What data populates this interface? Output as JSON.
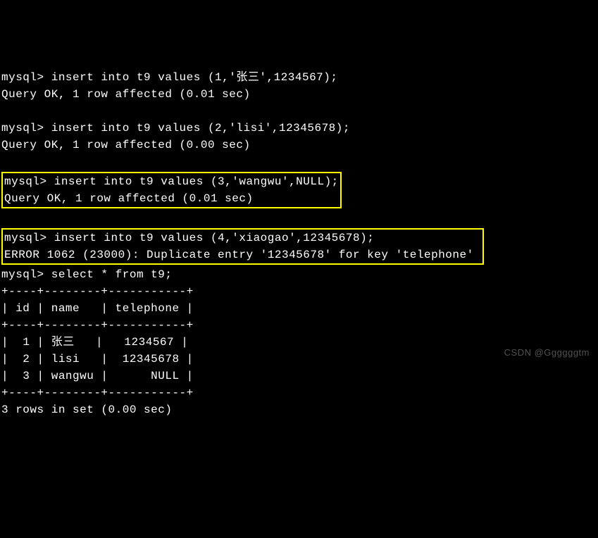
{
  "block1": {
    "prompt1": "mysql> ",
    "cmd1": "insert into t9 values (1,'张三',1234567);",
    "result1": "Query OK, 1 row affected (0.01 sec)"
  },
  "block2": {
    "prompt2": "mysql> ",
    "cmd2": "insert into t9 values (2,'lisi',12345678);",
    "result2": "Query OK, 1 row affected (0.00 sec)"
  },
  "block3": {
    "prompt3": "mysql> ",
    "cmd3": "insert into t9 values (3,'wangwu',NULL);",
    "result3": "Query OK, 1 row affected (0.01 sec)"
  },
  "block4": {
    "prompt4": "mysql> ",
    "cmd4": "insert into t9 values (4,'xiaogao',12345678);",
    "error4": "ERROR 1062 (23000): Duplicate entry '12345678' for key 'telephone'"
  },
  "block5": {
    "prompt5": "mysql> ",
    "cmd5": "select * from t9;"
  },
  "table": {
    "border": "+----+--------+-----------+",
    "header": "| id | name   | telephone |",
    "row1": "|  1 | 张三   |   1234567 |",
    "row2": "|  2 | lisi   |  12345678 |",
    "row3": "|  3 | wangwu |      NULL |",
    "footer": "3 rows in set (0.00 sec)"
  },
  "watermark": "CSDN @Ggggggtm"
}
